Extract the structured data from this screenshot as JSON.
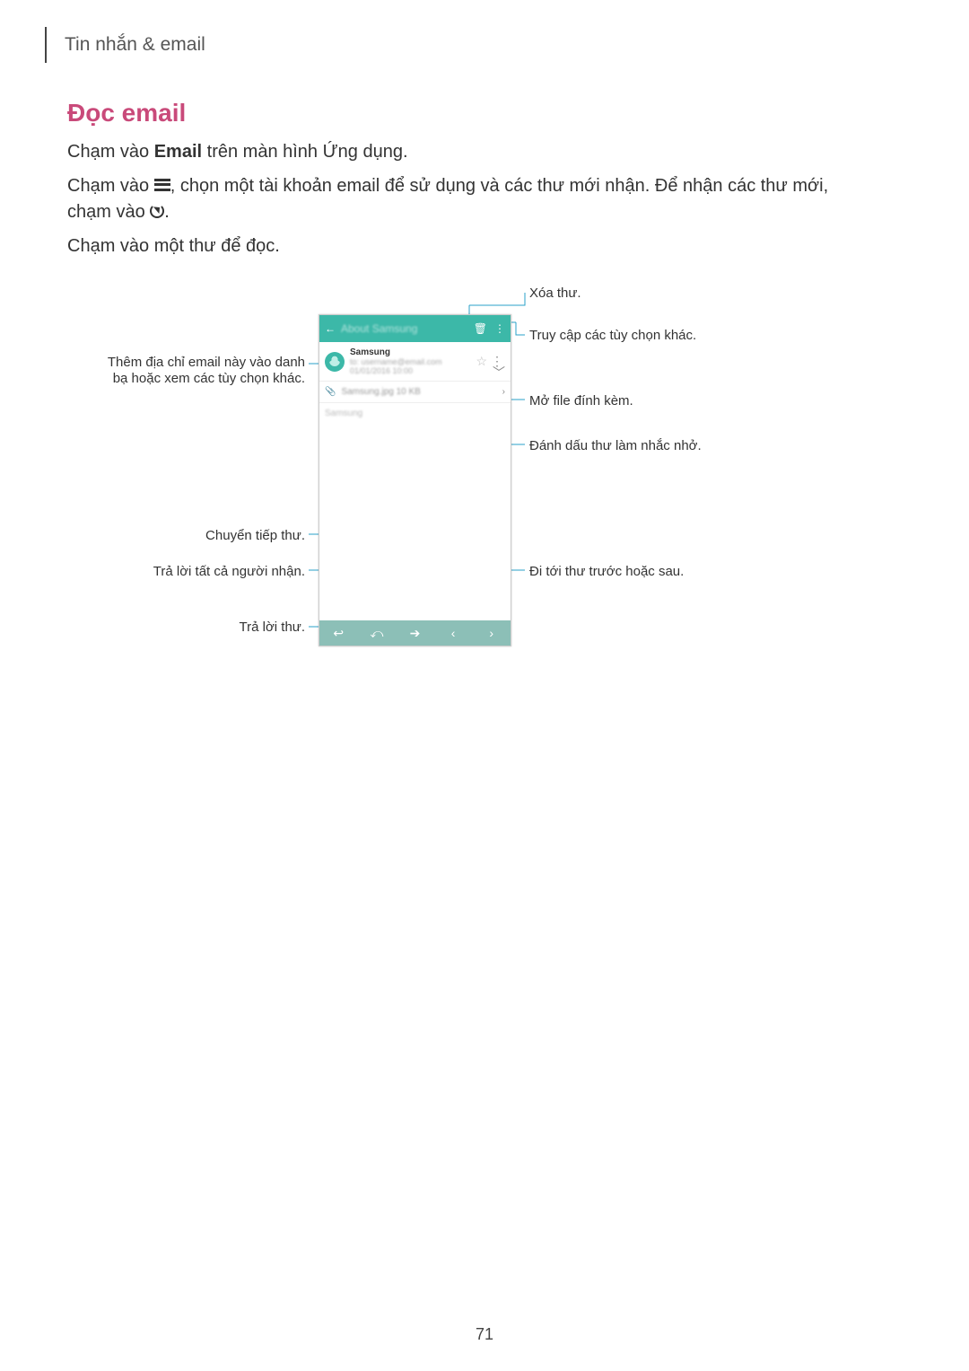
{
  "breadcrumb": "Tin nhắn & email",
  "heading": "Đọc email",
  "para1_pre": "Chạm vào ",
  "para1_bold": "Email",
  "para1_post": " trên màn hình Ứng dụng.",
  "para2_pre": "Chạm vào ",
  "para2_mid": ", chọn một tài khoản email để sử dụng và các thư mới nhận. Để nhận các thư mới, chạm vào ",
  "para2_end": ".",
  "para3": "Chạm vào một thư để đọc.",
  "callouts": {
    "delete": "Xóa thư.",
    "more": "Truy cập các tùy chọn khác.",
    "contact": "Thêm địa chỉ email này vào danh bạ hoặc xem các tùy chọn khác.",
    "attach": "Mở file đính kèm.",
    "remind": "Đánh dấu thư làm nhắc nhở.",
    "forward": "Chuyển tiếp thư.",
    "replyall": "Trả lời tất cả người nhận.",
    "reply": "Trả lời thư.",
    "prevnext": "Đi tới thư trước hoặc sau."
  },
  "phone": {
    "sender": "Samsung",
    "back": "←",
    "trash": "🗑",
    "dots": "⋮",
    "star": "☆",
    "chev": "﹀",
    "clip": "📎",
    "open": "›",
    "reply": "↩",
    "replyall": "⤺",
    "forward": "➔",
    "prev": "‹",
    "next": "›"
  },
  "page": "71"
}
